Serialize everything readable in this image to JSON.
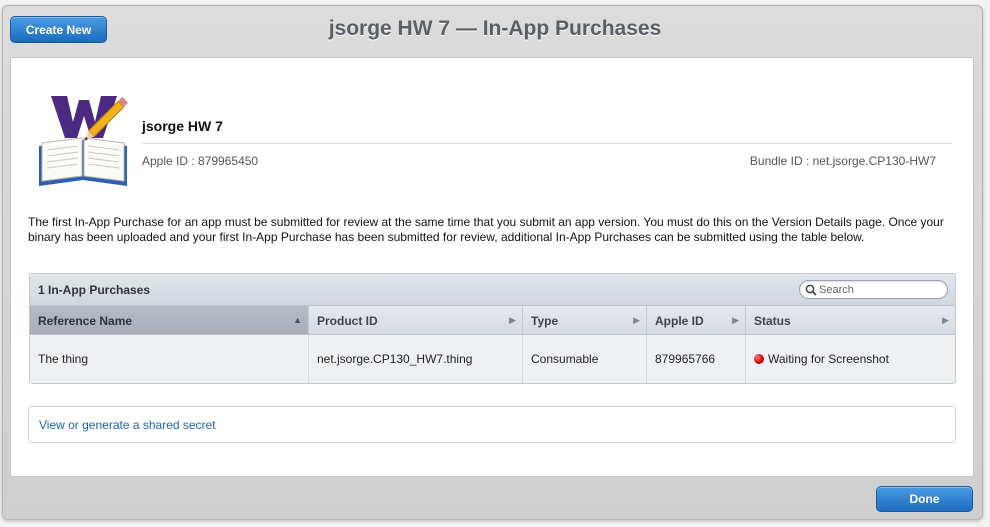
{
  "header": {
    "create_new_label": "Create New",
    "title": "jsorge HW 7 — In-App Purchases"
  },
  "app": {
    "name": "jsorge HW 7",
    "apple_id_line": "Apple ID : 879965450",
    "bundle_id_line": "Bundle ID : net.jsorge.CP130-HW7",
    "icon": "app-book-icon"
  },
  "info_text": "The first In-App Purchase for an app must be submitted for review at the same time that you submit an app version. You must do this on the Version Details page. Once your binary has been uploaded and your first In-App Purchase has been submitted for review, additional In-App Purchases can be submitted using the table below.",
  "iap": {
    "count_label": "1 In-App Purchases",
    "search": {
      "placeholder": "Search",
      "value": ""
    },
    "columns": [
      "Reference Name",
      "Product ID",
      "Type",
      "Apple ID",
      "Status"
    ],
    "rows": [
      {
        "reference_name": "The thing",
        "product_id": "net.jsorge.CP130_HW7.thing",
        "type": "Consumable",
        "apple_id": "879965766",
        "status": "Waiting for Screenshot"
      }
    ]
  },
  "secret_link": "View or generate a shared secret",
  "footer": {
    "done_label": "Done"
  },
  "colors": {
    "accent": "#1c6cc0",
    "link": "#1c64b0",
    "status_waiting": "#d00000",
    "title": "#5a5f66"
  }
}
